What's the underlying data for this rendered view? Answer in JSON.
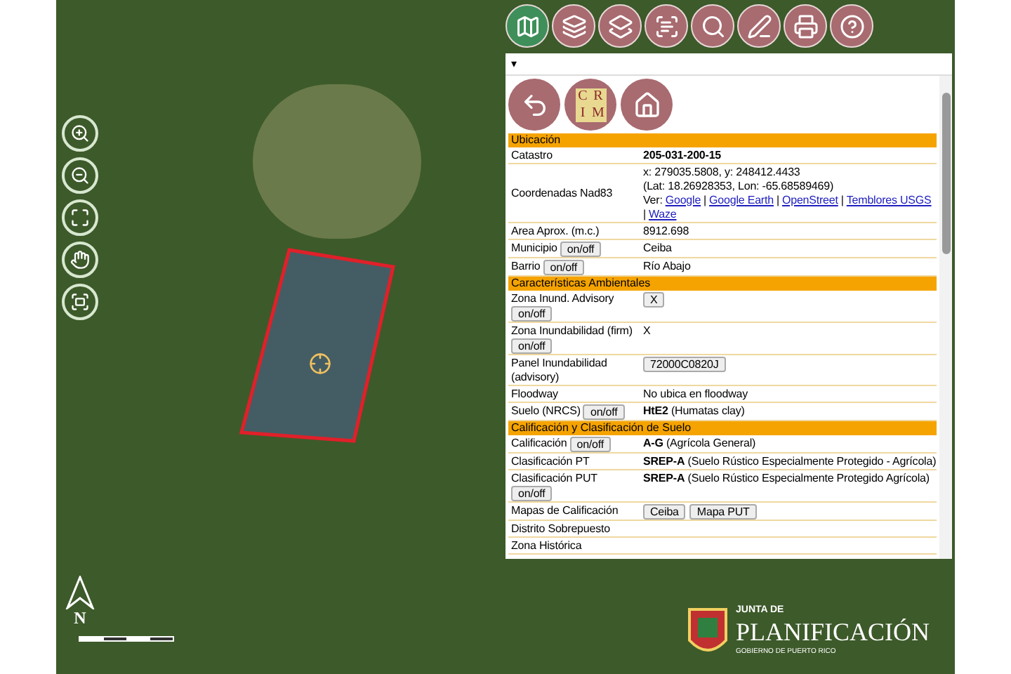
{
  "toolbar": {
    "collapse_glyph": "▾"
  },
  "panel_logo": {
    "letters": [
      "C",
      "R",
      "I",
      "M"
    ]
  },
  "sections": [
    {
      "title": "Ubicación",
      "rows": [
        {
          "label": "Catastro",
          "value": "**205-031-200-15**"
        },
        {
          "label": "Coordenadas Nad83",
          "lines": [
            "x: 279035.5808, y: 248412.4433",
            "(Lat: 18.26928353, Lon: -65.68589469)"
          ],
          "links_prefix": "Ver:",
          "links_separator": "|",
          "links": [
            "Google",
            "Google Earth",
            "OpenStreet",
            "Temblores USGS",
            "Waze"
          ]
        },
        {
          "label": "Area Aprox. (m.c.)",
          "value": "8912.698"
        },
        {
          "label": "Municipio",
          "toggle": "on/off",
          "value": "Ceiba"
        },
        {
          "label": "Barrio",
          "toggle": "on/off",
          "value": "Río Abajo"
        }
      ]
    },
    {
      "title": "Características Ambientales",
      "rows": [
        {
          "label": "Zona Inund. Advisory",
          "toggle": "on/off",
          "buttons": [
            "X"
          ]
        },
        {
          "label": "Zona Inundabilidad (firm)",
          "toggle": "on/off",
          "value": "X"
        },
        {
          "label": "Panel Inundabilidad (advisory)",
          "buttons": [
            "72000C0820J"
          ]
        },
        {
          "label": "Floodway",
          "value": "No ubica en floodway"
        },
        {
          "label": "Suelo (NRCS)",
          "toggle": "on/off",
          "value": "**HtE2** (Humatas clay)"
        }
      ]
    },
    {
      "title": "Calificación y Clasificación de Suelo",
      "rows": [
        {
          "label": "Calificación",
          "toggle": "on/off",
          "value": "**A-G** (Agrícola General)"
        },
        {
          "label": "Clasificación PT",
          "value": "**SREP-A** (Suelo Rústico Especialmente Protegido - Agrícola)"
        },
        {
          "label": "Clasificación PUT",
          "toggle": "on/off",
          "value": "**SREP-A** (Suelo Rústico Especialmente Protegido Agrícola)"
        },
        {
          "label": "Mapas de Calificación",
          "buttons": [
            "Ceiba",
            "Mapa PUT"
          ]
        },
        {
          "label": "Distrito Sobrepuesto"
        },
        {
          "label": "Zona Histórica"
        }
      ]
    }
  ],
  "north_arrow": {
    "letter": "N"
  },
  "logo": {
    "top": "JUNTA DE",
    "main": "PLANIFICACIÓN",
    "bottom": "GOBIERNO DE PUERTO RICO"
  }
}
